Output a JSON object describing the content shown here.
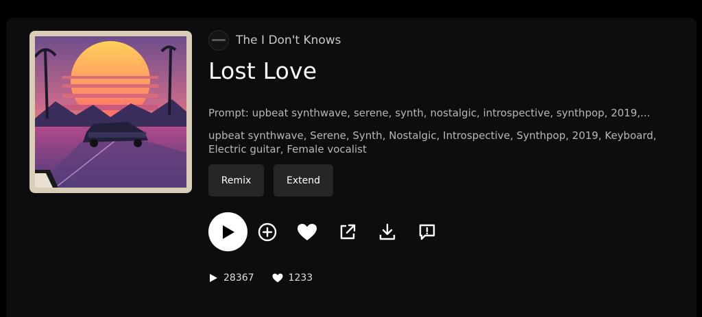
{
  "artist": {
    "name": "The I Don't Knows"
  },
  "song": {
    "title": "Lost Love",
    "prompt": "Prompt: upbeat synthwave, serene, synth, nostalgic, introspective, synthpop, 2019,...",
    "tags": "upbeat synthwave, Serene, Synth, Nostalgic, Introspective, Synthpop, 2019, Keyboard, Electric guitar, Female vocalist"
  },
  "buttons": {
    "remix": "Remix",
    "extend": "Extend"
  },
  "actions": [
    "play-icon",
    "add-icon",
    "heart-icon",
    "share-icon",
    "download-icon",
    "report-icon"
  ],
  "stats": {
    "plays": "28367",
    "likes": "1233"
  }
}
